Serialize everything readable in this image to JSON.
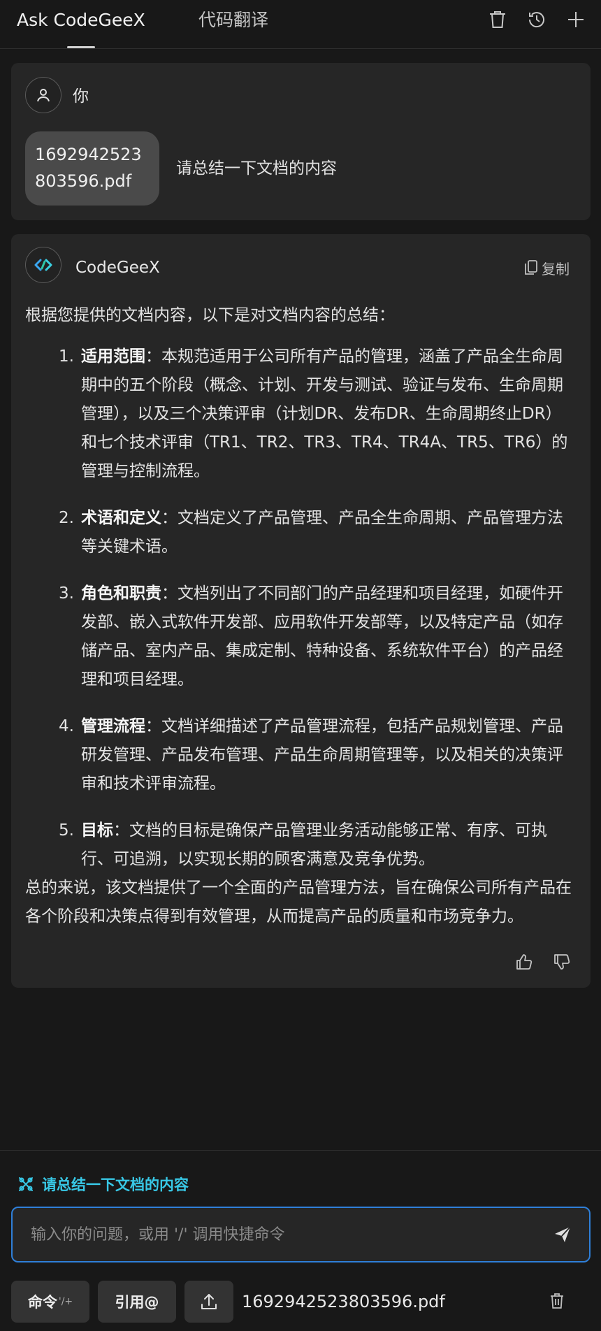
{
  "header": {
    "tabs": [
      {
        "label": "Ask CodeGeeX",
        "active": true
      },
      {
        "label": "代码翻译",
        "active": false
      }
    ],
    "icons": [
      "trash-icon",
      "history-icon",
      "plus-icon"
    ]
  },
  "user_message": {
    "author": "你",
    "file_label": "1692942523803596.pdf",
    "text": "请总结一下文档的内容"
  },
  "ai_message": {
    "author": "CodeGeeX",
    "copy_label": "复制",
    "intro": "根据您提供的文档内容，以下是对文档内容的总结：",
    "items": [
      {
        "num": "1.",
        "title": "适用范围",
        "text": "：本规范适用于公司所有产品的管理，涵盖了产品全生命周期中的五个阶段（概念、计划、开发与测试、验证与发布、生命周期管理），以及三个决策评审（计划DR、发布DR、生命周期终止DR）和七个技术评审（TR1、TR2、TR3、TR4、TR4A、TR5、TR6）的管理与控制流程。"
      },
      {
        "num": "2.",
        "title": "术语和定义",
        "text": "：文档定义了产品管理、产品全生命周期、产品管理方法等关键术语。"
      },
      {
        "num": "3.",
        "title": "角色和职责",
        "text": "：文档列出了不同部门的产品经理和项目经理，如硬件开发部、嵌入式软件开发部、应用软件开发部等，以及特定产品（如存储产品、室内产品、集成定制、特种设备、系统软件平台）的产品经理和项目经理。"
      },
      {
        "num": "4.",
        "title": "管理流程",
        "text": "：文档详细描述了产品管理流程，包括产品规划管理、产品研发管理、产品发布管理、产品生命周期管理等，以及相关的决策评审和技术评审流程。"
      },
      {
        "num": "5.",
        "title": "目标",
        "text": "：文档的目标是确保产品管理业务活动能够正常、有序、可执行、可追溯，以实现长期的顾客满意及竞争优势。"
      }
    ],
    "summary": "总的来说，该文档提供了一个全面的产品管理方法，旨在确保公司所有产品在各个阶段和决策点得到有效管理，从而提高产品的质量和市场竞争力。"
  },
  "suggestion": {
    "text": "请总结一下文档的内容"
  },
  "input": {
    "placeholder": "输入你的问题，或用 '/' 调用快捷命令",
    "value": ""
  },
  "toolbar": {
    "command_label": "命令",
    "command_shortcut": "'/+",
    "reference_label": "引用@",
    "attached_file": "1692942523803596.pdf"
  },
  "colors": {
    "accent": "#38c8e6",
    "input_border": "#2f7fd8",
    "background": "#181818",
    "card": "#262626"
  }
}
